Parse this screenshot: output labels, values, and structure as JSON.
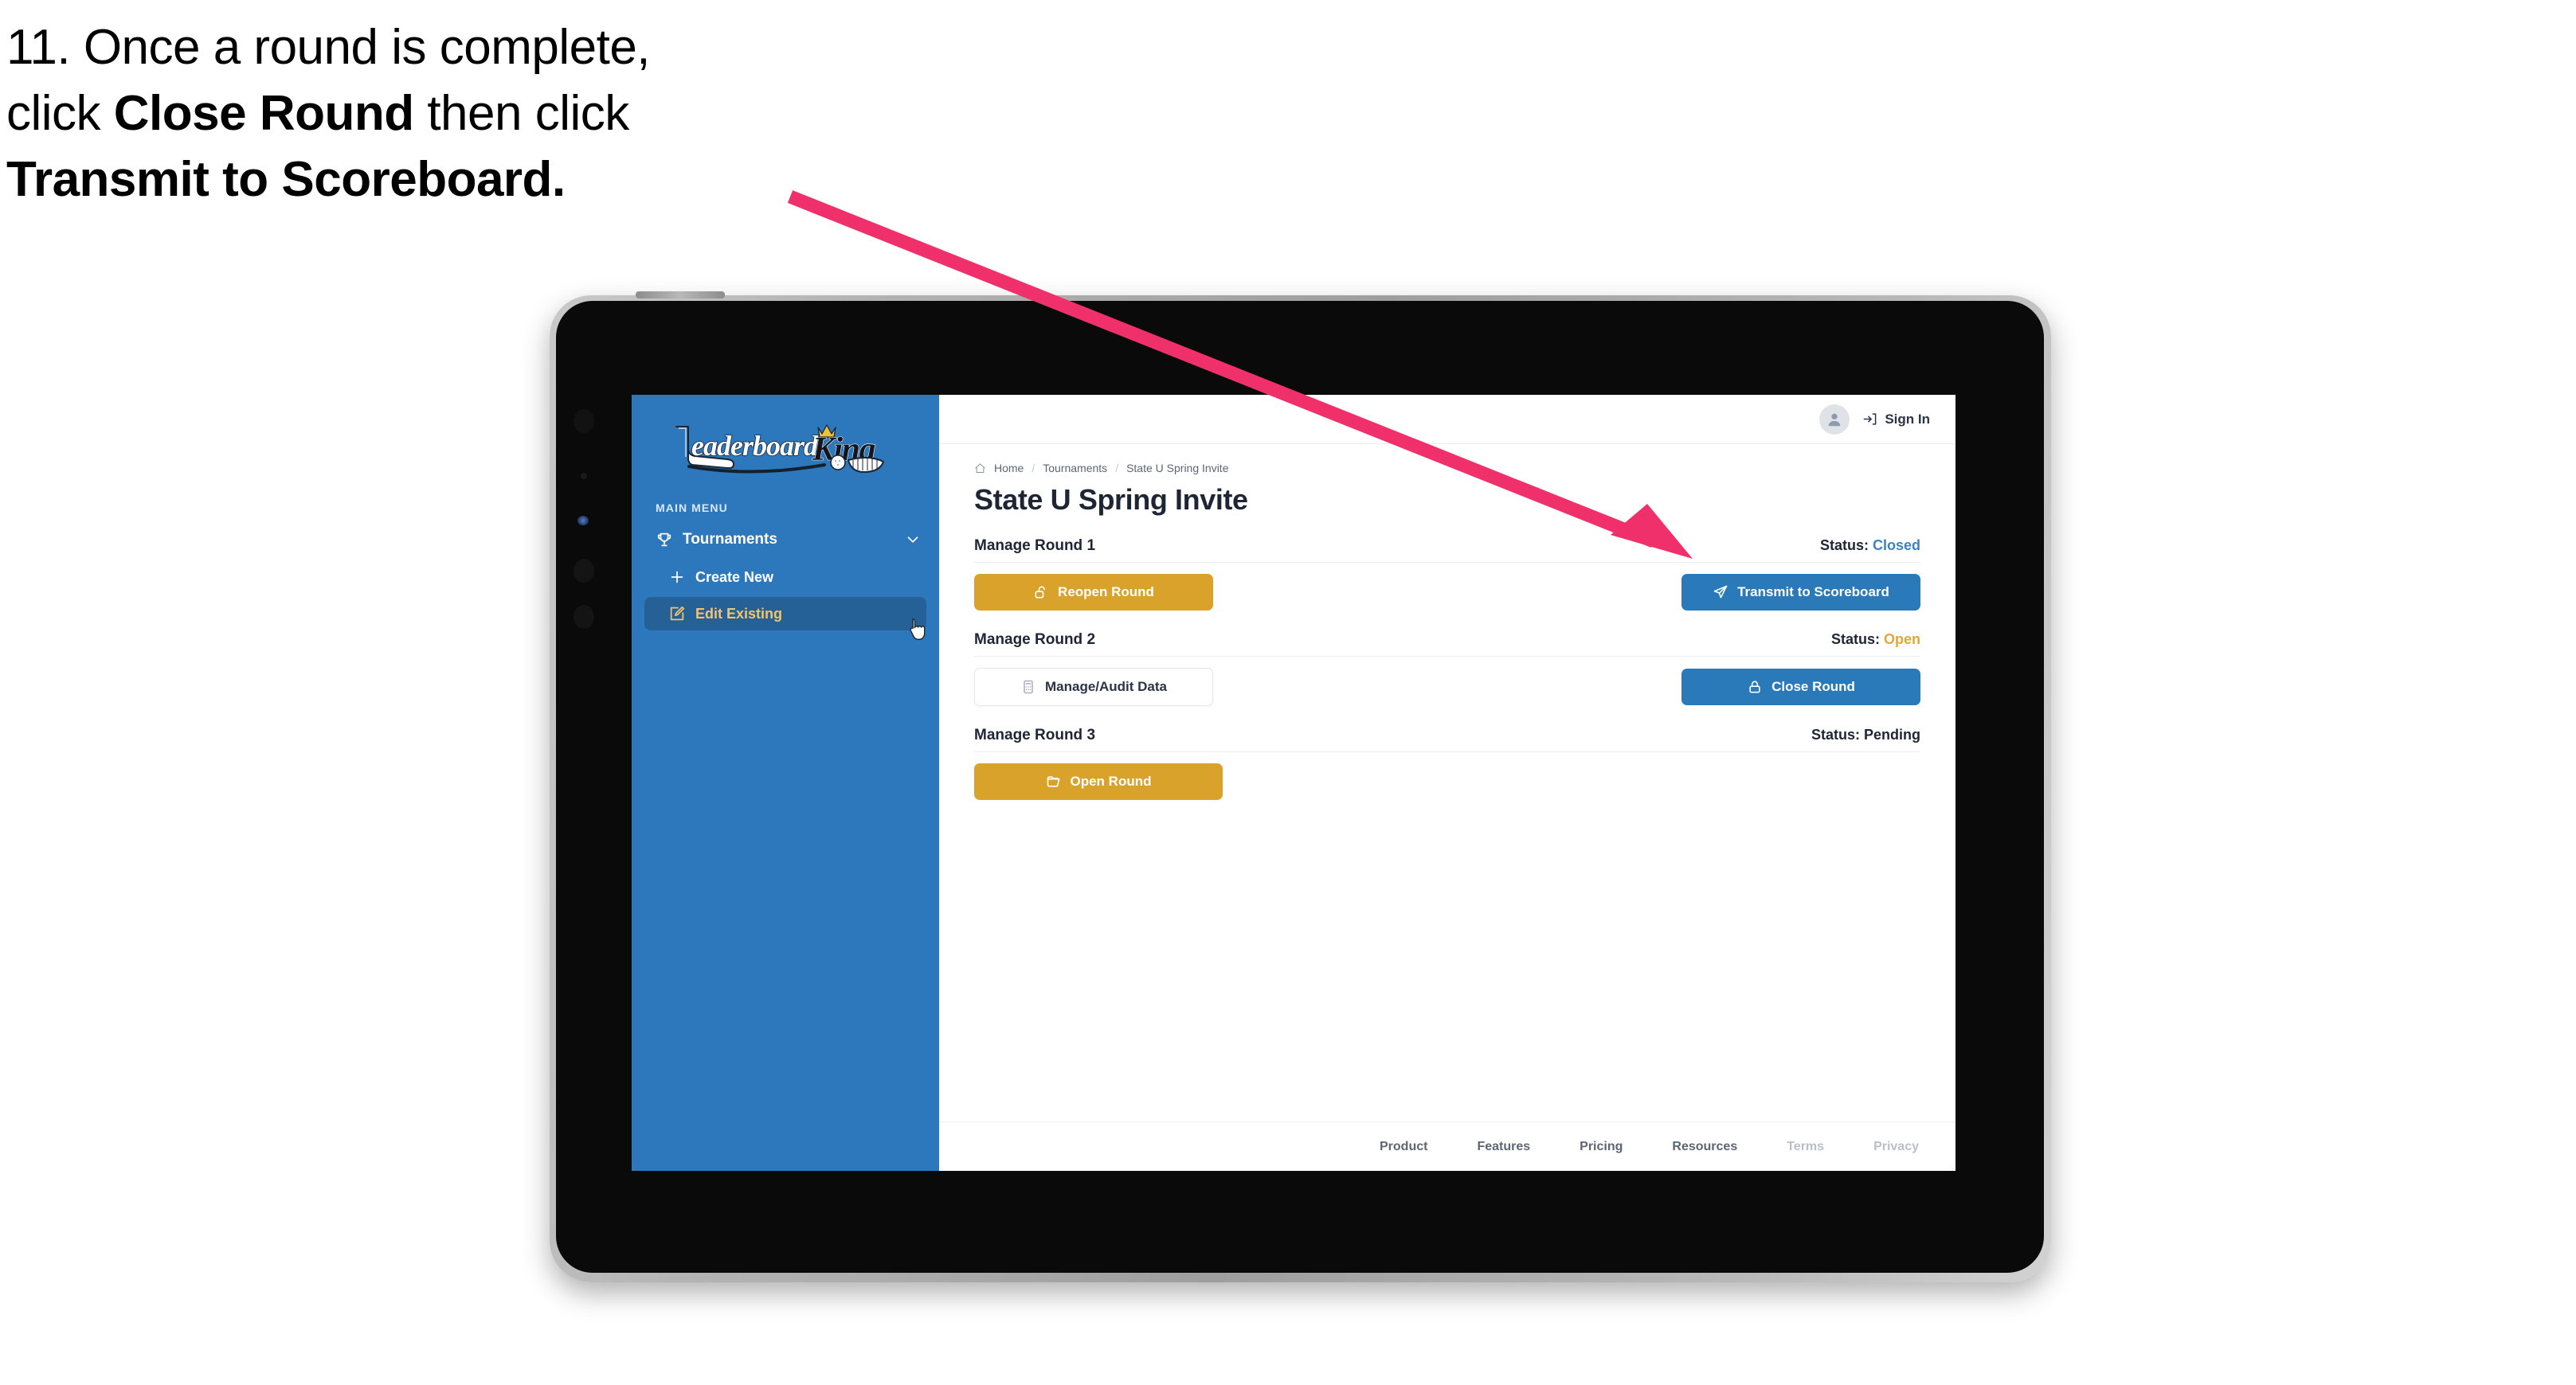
{
  "annotation": {
    "step_number": "11.",
    "line1_pre": "11. Once a round is complete,",
    "line2_pre": "click ",
    "line2_bold": "Close Round",
    "line2_post": " then click",
    "line3_bold": "Transmit to Scoreboard.",
    "arrow_color": "#f0306a"
  },
  "colors": {
    "sidebar_blue": "#2d77bc",
    "sidebar_active": "#256196",
    "sidebar_active_text": "#f2c46b",
    "gold_button": "#d9a32b",
    "blue_button": "#2a7ab9",
    "status_closed": "#3b82c4",
    "status_open": "#e0a73a",
    "status_pending": "#1e2535"
  },
  "sidebar": {
    "logo_text": "LeaderboardKing",
    "logo_word_1": "Leaderboard",
    "logo_word_2": "King",
    "section_label": "MAIN MENU",
    "items": [
      {
        "label": "Tournaments",
        "icon": "trophy-icon",
        "chevron": "chevron-down-icon",
        "active": false
      },
      {
        "label": "Create New",
        "icon": "plus-icon",
        "active": false
      },
      {
        "label": "Edit Existing",
        "icon": "edit-square-icon",
        "active": true
      }
    ]
  },
  "topbar": {
    "avatar_icon": "user-avatar-icon",
    "signin_icon": "sign-in-icon",
    "signin_label": "Sign In"
  },
  "breadcrumb": {
    "home_icon": "home-icon",
    "items": [
      "Home",
      "Tournaments",
      "State U Spring Invite"
    ],
    "separator": "/"
  },
  "page": {
    "title": "State U Spring Invite"
  },
  "rounds": [
    {
      "title": "Manage Round 1",
      "status_label": "Status:",
      "status_value": "Closed",
      "status_kind": "closed",
      "left_button": {
        "label": "Reopen Round",
        "icon": "unlock-icon",
        "style": "gold"
      },
      "right_button": {
        "label": "Transmit to Scoreboard",
        "icon": "send-icon",
        "style": "blue"
      }
    },
    {
      "title": "Manage Round 2",
      "status_label": "Status:",
      "status_value": "Open",
      "status_kind": "open",
      "left_button": {
        "label": "Manage/Audit Data",
        "icon": "calculator-icon",
        "style": "ghost"
      },
      "right_button": {
        "label": "Close Round",
        "icon": "lock-icon",
        "style": "blue"
      }
    },
    {
      "title": "Manage Round 3",
      "status_label": "Status:",
      "status_value": "Pending",
      "status_kind": "pending",
      "left_button": {
        "label": "Open Round",
        "icon": "folder-open-icon",
        "style": "gold"
      },
      "right_button": null
    }
  ],
  "footer": {
    "links": [
      {
        "label": "Product",
        "muted": false
      },
      {
        "label": "Features",
        "muted": false
      },
      {
        "label": "Pricing",
        "muted": false
      },
      {
        "label": "Resources",
        "muted": false
      },
      {
        "label": "Terms",
        "muted": true
      },
      {
        "label": "Privacy",
        "muted": true
      }
    ]
  }
}
